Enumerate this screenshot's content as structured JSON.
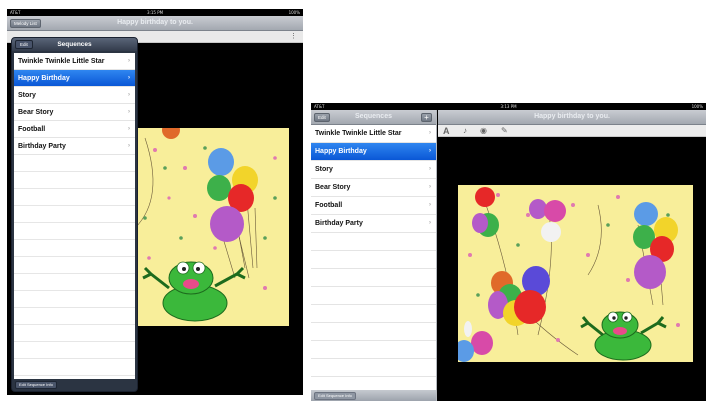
{
  "left": {
    "status": {
      "carrier": "AT&T",
      "time": "3:15 PM",
      "battery": "100%"
    },
    "nav": {
      "back_label": "Melody List",
      "title": "Happy birthday to you."
    },
    "toolbar": {
      "menu_icon": "more-vert-icon"
    },
    "popover": {
      "title": "Sequences",
      "edit_label": "Edit",
      "items": [
        {
          "label": "Twinkle Twinkle Little Star",
          "selected": false
        },
        {
          "label": "Happy Birthday",
          "selected": true
        },
        {
          "label": "Story",
          "selected": false
        },
        {
          "label": "Bear Story",
          "selected": false
        },
        {
          "label": "Football",
          "selected": false
        },
        {
          "label": "Birthday Party",
          "selected": false
        }
      ],
      "footer_label": "Edit Sequence Info"
    }
  },
  "right": {
    "status": {
      "carrier": "AT&T",
      "time": "3:13 PM",
      "battery": "100%"
    },
    "master": {
      "edit_label": "Edit",
      "title": "Sequences",
      "add_label": "+",
      "items": [
        {
          "label": "Twinkle Twinkle Little Star",
          "selected": false
        },
        {
          "label": "Happy Birthday",
          "selected": true
        },
        {
          "label": "Story",
          "selected": false
        },
        {
          "label": "Bear Story",
          "selected": false
        },
        {
          "label": "Football",
          "selected": false
        },
        {
          "label": "Birthday Party",
          "selected": false
        }
      ],
      "footer_label": "Edit Sequence Info"
    },
    "detail": {
      "title": "Happy birthday to you.",
      "tools": [
        {
          "glyph": "A",
          "icon": "text-icon"
        },
        {
          "glyph": "♪",
          "icon": "music-note-icon"
        },
        {
          "glyph": "◉",
          "icon": "eye-icon"
        },
        {
          "glyph": "✎",
          "icon": "draw-icon"
        }
      ]
    }
  },
  "colors": {
    "selection": "#0a57d6",
    "art_background": "#f8ee9a",
    "frog": "#3bb83b"
  }
}
